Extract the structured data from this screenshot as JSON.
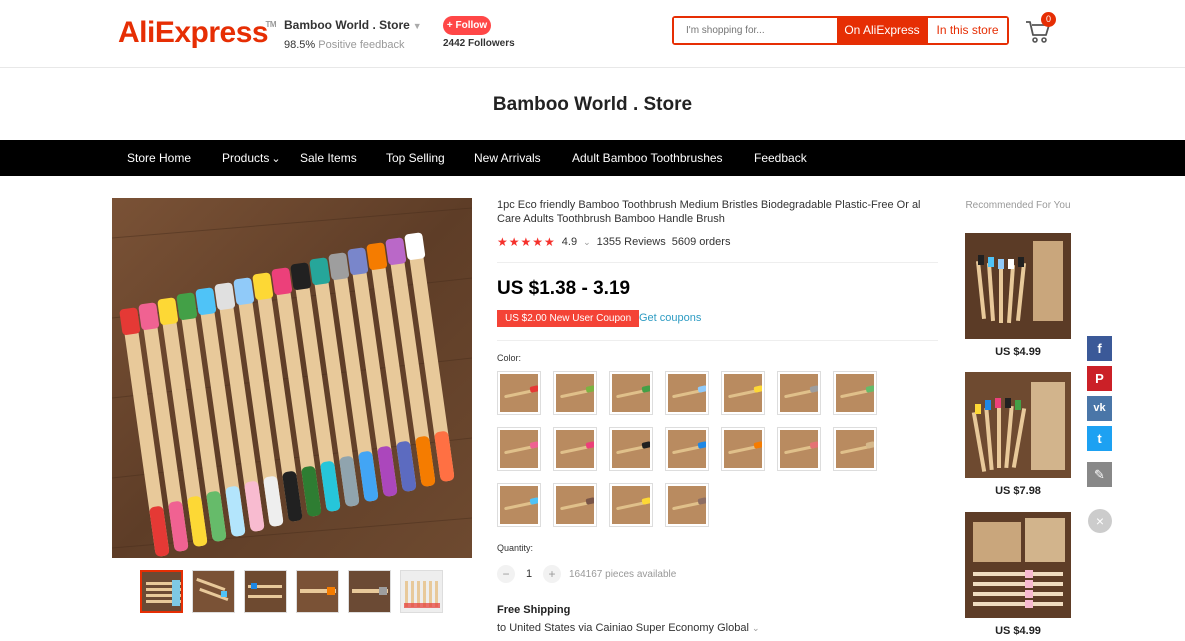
{
  "header": {
    "logo_text_1": "Ali",
    "logo_text_2": "Express",
    "store_name": "Bamboo World . Store",
    "feedback_percent": "98.5%",
    "feedback_label": "Positive feedback",
    "follow_label": "+ Follow",
    "followers": "2442 Followers",
    "search_placeholder": "I'm shopping for...",
    "search_ali_label": "On AliExpress",
    "search_store_label": "In this store",
    "cart_count": "0",
    "logo_trademark": "TM"
  },
  "store_title": "Bamboo World . Store",
  "nav": [
    {
      "label": "Store Home"
    },
    {
      "label": "Products"
    },
    {
      "label": "Sale Items"
    },
    {
      "label": "Top Selling"
    },
    {
      "label": "New Arrivals"
    },
    {
      "label": "Adult Bamboo Toothbrushes"
    },
    {
      "label": "Feedback"
    }
  ],
  "product": {
    "title": "1pc Eco friendly Bamboo Toothbrush Medium Bristles Biodegradable Plastic-Free Or al Care Adults Toothbrush Bamboo Handle Brush",
    "stars": "★★★★★",
    "rating": "4.9",
    "reviews": "1355 Reviews",
    "orders": "5609 orders",
    "price": "US $1.38 - 3.19",
    "coupon": "US $2.00 New User Coupon",
    "get_coupons": "Get coupons",
    "color_label": "Color:",
    "swatch_colors": [
      "#e53935",
      "#7cb342",
      "#43a047",
      "#90caf9",
      "#fdd835",
      "#9e9e9e",
      "#66bb6a",
      "#f06292",
      "#ec407a",
      "#212121",
      "#1e88e5",
      "#f57c00",
      "#e57373",
      "#d6b88a",
      "#4fc3f7",
      "#795548",
      "#fdd835",
      "#8d6e63"
    ],
    "quantity_label": "Quantity:",
    "quantity": "1",
    "minus": "−",
    "plus": "+",
    "available": "164167 pieces available",
    "shipping_title": "Free Shipping",
    "shipping_line": "to United States via Cainiao Super Economy Global"
  },
  "recommended": {
    "title": "Recommended For You",
    "items": [
      {
        "price": "US $4.99"
      },
      {
        "price": "US $7.98"
      },
      {
        "price": "US $4.99"
      }
    ]
  },
  "share": [
    {
      "icon": "facebook-icon",
      "glyph": "f",
      "color": "#3b5998"
    },
    {
      "icon": "pinterest-icon",
      "glyph": "P",
      "color": "#cb2027"
    },
    {
      "icon": "vk-icon",
      "glyph": "vk",
      "color": "#4a76a8"
    },
    {
      "icon": "twitter-icon",
      "glyph": "t",
      "color": "#1da1f2"
    },
    {
      "icon": "pen-icon",
      "glyph": "✎",
      "color": "#888888"
    }
  ],
  "close_glyph": "×",
  "colors": {
    "accent": "#e62e04",
    "link": "#2e9cc3",
    "nav_bg": "#000000"
  }
}
